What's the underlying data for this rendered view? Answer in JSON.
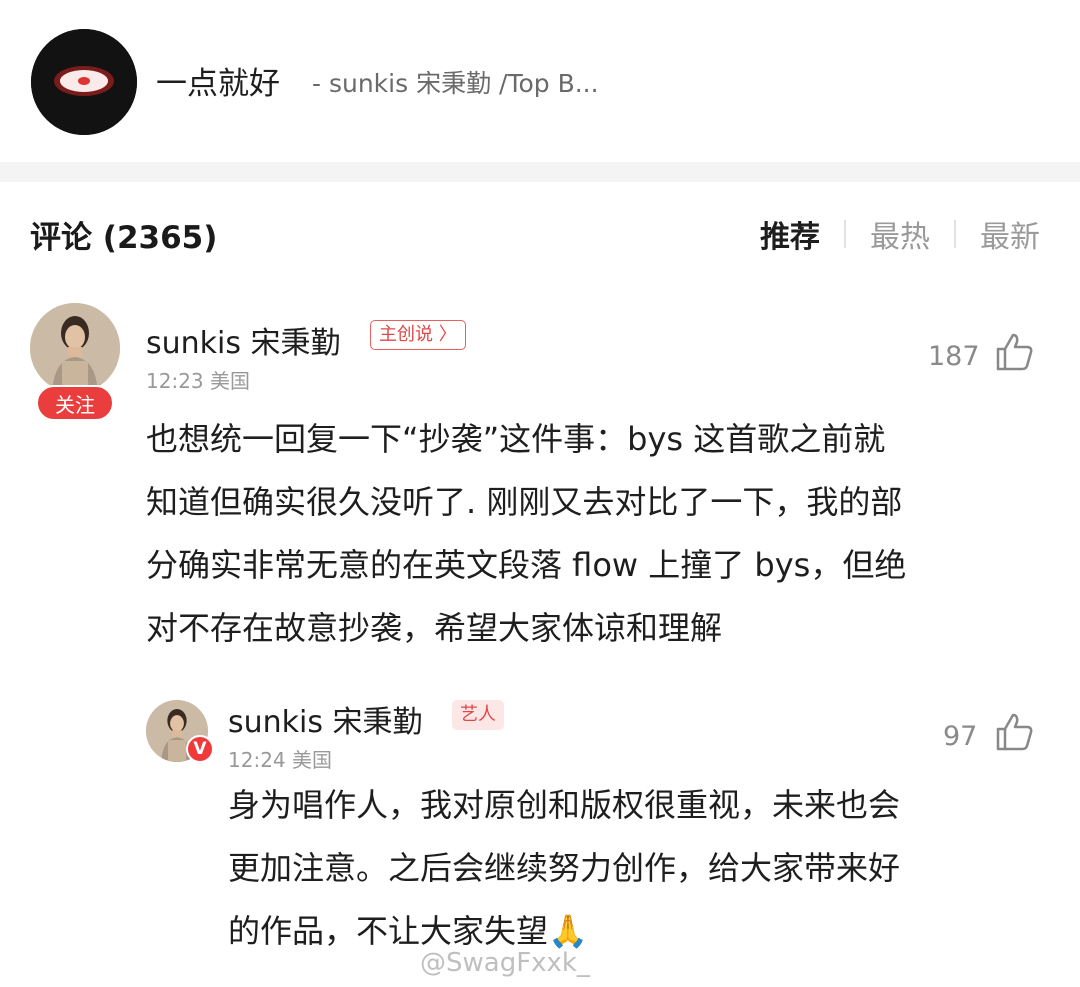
{
  "song": {
    "title": "一点就好",
    "subtitle": "- sunkis 宋秉勤 /Top B..."
  },
  "comments_header": {
    "title": "评论 (2365)",
    "tabs": [
      "推荐",
      "最热",
      "最新"
    ],
    "active_tab": "推荐"
  },
  "comment": {
    "username": "sunkis 宋秉勤",
    "tag": "主创说 〉",
    "time_location": "12:23 美国",
    "likes": "187",
    "follow_label": "关注",
    "lines": [
      "也想统一回复一下“抄袭”这件事：bys 这首歌之前就",
      "知道但确实很久没听了. 刚刚又去对比了一下，我的部",
      "分确实非常无意的在英文段落 flow 上撞了 bys，但绝",
      "对不存在故意抄袭，希望大家体谅和理解"
    ]
  },
  "reply": {
    "username": "sunkis 宋秉勤",
    "tag": "艺人",
    "verified_badge": "V",
    "time_location": "12:24 美国",
    "likes": "97",
    "lines": [
      "身为唱作人，我对原创和版权很重视，未来也会",
      "更加注意。之后会继续努力创作，给大家带来好",
      "的作品，不让大家失望🙏"
    ]
  },
  "watermark": "@SwagFxxk_",
  "icons": {
    "like": "thumbs-up-icon",
    "cover": "album-cover-icon"
  },
  "colors": {
    "accent_red": "#ea3e3e",
    "tag_red": "#e04848",
    "muted": "#999999"
  }
}
